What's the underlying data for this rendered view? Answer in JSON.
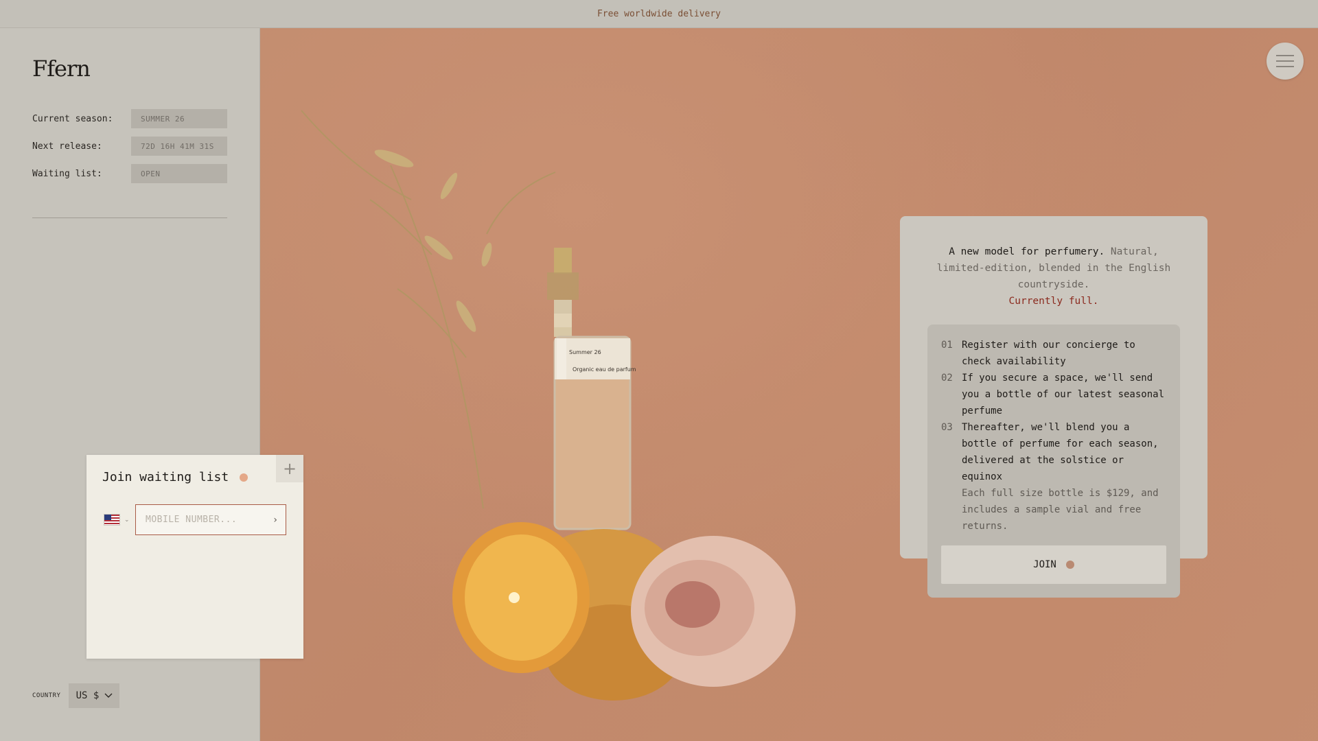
{
  "announcement": "Free worldwide delivery",
  "brand": {
    "logo_text": "Ffern"
  },
  "status": {
    "current_season_label": "Current season:",
    "current_season_value": "SUMMER 26",
    "next_release_label": "Next release:",
    "next_release_value": "72D 16H 41M 31S",
    "waiting_list_label": "Waiting list:",
    "waiting_list_value": "OPEN"
  },
  "country": {
    "label": "COUNTRY",
    "currency": "US $"
  },
  "hero": {
    "intro_lead": "A new model for perfumery.",
    "intro_rest": " Natural, limited-edition, blended in the English countryside.",
    "intro_status": "Currently full.",
    "steps": [
      {
        "num": "01",
        "text": "Register with our concierge to check availability"
      },
      {
        "num": "02",
        "text": "If you secure a space, we'll send you a bottle of our latest seasonal perfume"
      },
      {
        "num": "03",
        "text": "Thereafter, we'll blend you a bottle of perfume for each season, delivered at the solstice or equinox"
      }
    ],
    "footnote": "Each full size bottle is $129, and includes a sample vial and free returns.",
    "join_label": "JOIN"
  },
  "waiting_list": {
    "title": "Join waiting list",
    "placeholder": "MOBILE NUMBER...",
    "submit": "›"
  },
  "colors": {
    "accent_red": "#8b2a1e",
    "dot": "#b98a72",
    "hero_bg": "#c28c6f"
  },
  "icons": {
    "menu": "hamburger-icon",
    "plus": "plus-icon",
    "flag": "us-flag-icon",
    "chevron": "chevron-down-icon"
  }
}
